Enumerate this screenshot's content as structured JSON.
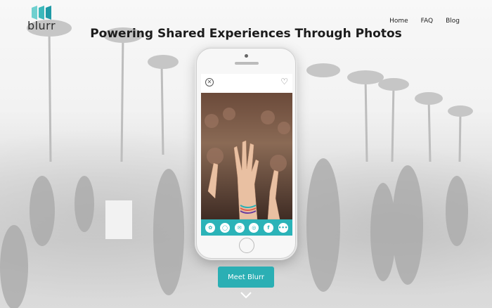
{
  "brand": {
    "name": "blurr",
    "accent": "#2bafb4"
  },
  "nav": {
    "items": [
      "Home",
      "FAQ",
      "Blog"
    ]
  },
  "hero": {
    "headline": "Powering Shared Experiences Through Photos",
    "cta_label": "Meet Blurr"
  },
  "phone_ui": {
    "share_icons": [
      "snapchat-icon",
      "messages-icon",
      "messenger-icon",
      "instagram-icon",
      "facebook-icon",
      "more-icon"
    ],
    "share_glyphs": [
      "✿",
      "◯",
      "✉",
      "◎",
      "f",
      "•••"
    ]
  },
  "icons": {
    "close": "close-icon",
    "heart": "heart-icon",
    "scroll": "chevron-down-icon"
  }
}
